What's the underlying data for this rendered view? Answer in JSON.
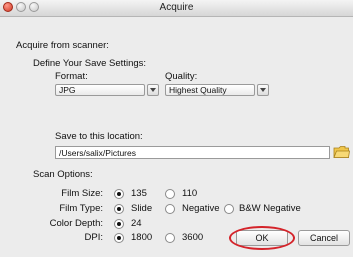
{
  "window": {
    "title": "Acquire"
  },
  "colors": {
    "highlight": "#d4232a",
    "folder": "#e8b93a"
  },
  "acquire_label": "Acquire from scanner:",
  "save_settings": {
    "heading": "Define Your Save Settings:",
    "format_label": "Format:",
    "format_value": "JPG",
    "quality_label": "Quality:",
    "quality_value": "Highest Quality",
    "location_label": "Save to this location:",
    "location_value": "/Users/salix/Pictures"
  },
  "scan_options": {
    "heading": "Scan Options:",
    "film_size_label": "Film Size:",
    "film_size_options": [
      "135",
      "110"
    ],
    "film_size_selected": "135",
    "film_type_label": "Film Type:",
    "film_type_options": [
      "Slide",
      "Negative",
      "B&W Negative"
    ],
    "film_type_selected": "Slide",
    "color_depth_label": "Color Depth:",
    "color_depth_options": [
      "24"
    ],
    "color_depth_selected": "24",
    "dpi_label": "DPI:",
    "dpi_options": [
      "1800",
      "3600"
    ],
    "dpi_selected": "1800"
  },
  "buttons": {
    "ok": "OK",
    "cancel": "Cancel"
  },
  "icons": {
    "folder": "folder-icon"
  }
}
